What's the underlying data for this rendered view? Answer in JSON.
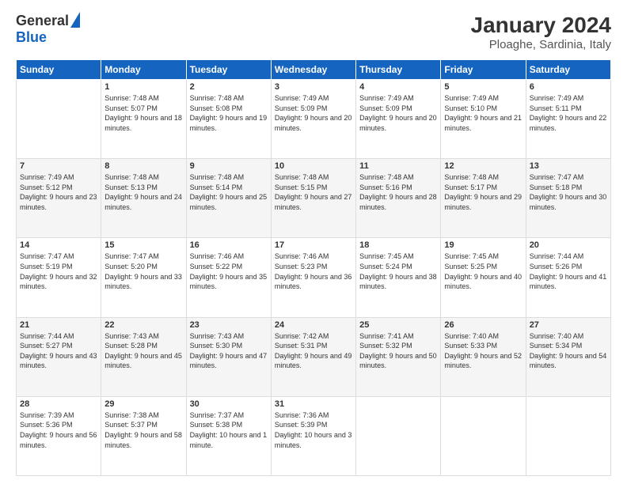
{
  "header": {
    "logo_general": "General",
    "logo_blue": "Blue",
    "month_title": "January 2024",
    "location": "Ploaghe, Sardinia, Italy"
  },
  "weekdays": [
    "Sunday",
    "Monday",
    "Tuesday",
    "Wednesday",
    "Thursday",
    "Friday",
    "Saturday"
  ],
  "weeks": [
    [
      {
        "day": "",
        "sunrise": "",
        "sunset": "",
        "daylight": ""
      },
      {
        "day": "1",
        "sunrise": "7:48 AM",
        "sunset": "5:07 PM",
        "daylight": "9 hours and 18 minutes."
      },
      {
        "day": "2",
        "sunrise": "7:48 AM",
        "sunset": "5:08 PM",
        "daylight": "9 hours and 19 minutes."
      },
      {
        "day": "3",
        "sunrise": "7:49 AM",
        "sunset": "5:09 PM",
        "daylight": "9 hours and 20 minutes."
      },
      {
        "day": "4",
        "sunrise": "7:49 AM",
        "sunset": "5:09 PM",
        "daylight": "9 hours and 20 minutes."
      },
      {
        "day": "5",
        "sunrise": "7:49 AM",
        "sunset": "5:10 PM",
        "daylight": "9 hours and 21 minutes."
      },
      {
        "day": "6",
        "sunrise": "7:49 AM",
        "sunset": "5:11 PM",
        "daylight": "9 hours and 22 minutes."
      }
    ],
    [
      {
        "day": "7",
        "sunrise": "7:49 AM",
        "sunset": "5:12 PM",
        "daylight": "9 hours and 23 minutes."
      },
      {
        "day": "8",
        "sunrise": "7:48 AM",
        "sunset": "5:13 PM",
        "daylight": "9 hours and 24 minutes."
      },
      {
        "day": "9",
        "sunrise": "7:48 AM",
        "sunset": "5:14 PM",
        "daylight": "9 hours and 25 minutes."
      },
      {
        "day": "10",
        "sunrise": "7:48 AM",
        "sunset": "5:15 PM",
        "daylight": "9 hours and 27 minutes."
      },
      {
        "day": "11",
        "sunrise": "7:48 AM",
        "sunset": "5:16 PM",
        "daylight": "9 hours and 28 minutes."
      },
      {
        "day": "12",
        "sunrise": "7:48 AM",
        "sunset": "5:17 PM",
        "daylight": "9 hours and 29 minutes."
      },
      {
        "day": "13",
        "sunrise": "7:47 AM",
        "sunset": "5:18 PM",
        "daylight": "9 hours and 30 minutes."
      }
    ],
    [
      {
        "day": "14",
        "sunrise": "7:47 AM",
        "sunset": "5:19 PM",
        "daylight": "9 hours and 32 minutes."
      },
      {
        "day": "15",
        "sunrise": "7:47 AM",
        "sunset": "5:20 PM",
        "daylight": "9 hours and 33 minutes."
      },
      {
        "day": "16",
        "sunrise": "7:46 AM",
        "sunset": "5:22 PM",
        "daylight": "9 hours and 35 minutes."
      },
      {
        "day": "17",
        "sunrise": "7:46 AM",
        "sunset": "5:23 PM",
        "daylight": "9 hours and 36 minutes."
      },
      {
        "day": "18",
        "sunrise": "7:45 AM",
        "sunset": "5:24 PM",
        "daylight": "9 hours and 38 minutes."
      },
      {
        "day": "19",
        "sunrise": "7:45 AM",
        "sunset": "5:25 PM",
        "daylight": "9 hours and 40 minutes."
      },
      {
        "day": "20",
        "sunrise": "7:44 AM",
        "sunset": "5:26 PM",
        "daylight": "9 hours and 41 minutes."
      }
    ],
    [
      {
        "day": "21",
        "sunrise": "7:44 AM",
        "sunset": "5:27 PM",
        "daylight": "9 hours and 43 minutes."
      },
      {
        "day": "22",
        "sunrise": "7:43 AM",
        "sunset": "5:28 PM",
        "daylight": "9 hours and 45 minutes."
      },
      {
        "day": "23",
        "sunrise": "7:43 AM",
        "sunset": "5:30 PM",
        "daylight": "9 hours and 47 minutes."
      },
      {
        "day": "24",
        "sunrise": "7:42 AM",
        "sunset": "5:31 PM",
        "daylight": "9 hours and 49 minutes."
      },
      {
        "day": "25",
        "sunrise": "7:41 AM",
        "sunset": "5:32 PM",
        "daylight": "9 hours and 50 minutes."
      },
      {
        "day": "26",
        "sunrise": "7:40 AM",
        "sunset": "5:33 PM",
        "daylight": "9 hours and 52 minutes."
      },
      {
        "day": "27",
        "sunrise": "7:40 AM",
        "sunset": "5:34 PM",
        "daylight": "9 hours and 54 minutes."
      }
    ],
    [
      {
        "day": "28",
        "sunrise": "7:39 AM",
        "sunset": "5:36 PM",
        "daylight": "9 hours and 56 minutes."
      },
      {
        "day": "29",
        "sunrise": "7:38 AM",
        "sunset": "5:37 PM",
        "daylight": "9 hours and 58 minutes."
      },
      {
        "day": "30",
        "sunrise": "7:37 AM",
        "sunset": "5:38 PM",
        "daylight": "10 hours and 1 minute."
      },
      {
        "day": "31",
        "sunrise": "7:36 AM",
        "sunset": "5:39 PM",
        "daylight": "10 hours and 3 minutes."
      },
      {
        "day": "",
        "sunrise": "",
        "sunset": "",
        "daylight": ""
      },
      {
        "day": "",
        "sunrise": "",
        "sunset": "",
        "daylight": ""
      },
      {
        "day": "",
        "sunrise": "",
        "sunset": "",
        "daylight": ""
      }
    ]
  ]
}
